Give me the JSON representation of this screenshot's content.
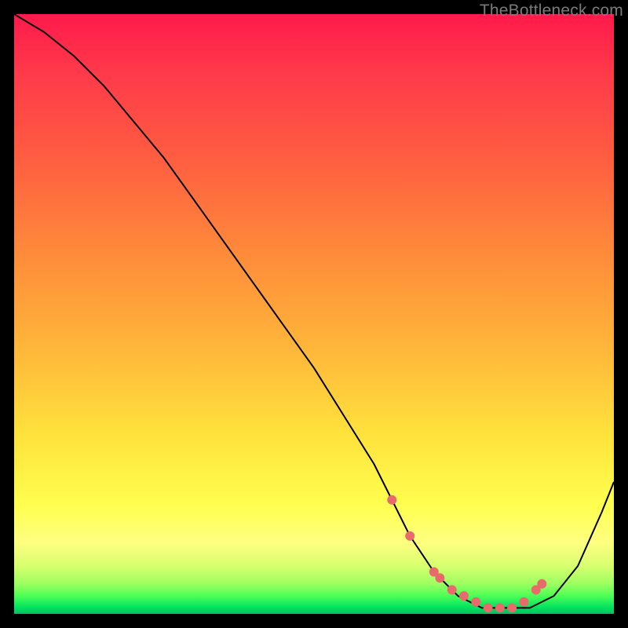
{
  "watermark": "TheBottleneck.com",
  "chart_data": {
    "type": "line",
    "title": "",
    "xlabel": "",
    "ylabel": "",
    "xlim": [
      0,
      100
    ],
    "ylim": [
      0,
      100
    ],
    "grid": false,
    "series": [
      {
        "name": "bottleneck-curve",
        "color": "#000000",
        "x": [
          0,
          5,
          10,
          15,
          20,
          25,
          30,
          35,
          40,
          45,
          50,
          55,
          60,
          63,
          66,
          70,
          74,
          78,
          82,
          86,
          90,
          94,
          98,
          100
        ],
        "y": [
          100,
          97,
          93,
          88,
          82,
          76,
          69,
          62,
          55,
          48,
          41,
          33,
          25,
          19,
          13,
          7,
          3,
          1,
          1,
          1,
          3,
          8,
          17,
          22
        ]
      },
      {
        "name": "optimal-zone-markers",
        "color": "#e86a6a",
        "type": "scatter",
        "x": [
          63,
          66,
          70,
          71,
          73,
          75,
          77,
          79,
          81,
          83,
          85,
          87,
          88
        ],
        "y": [
          19,
          13,
          7,
          6,
          4,
          3,
          2,
          1,
          1,
          1,
          2,
          4,
          5
        ]
      }
    ]
  }
}
